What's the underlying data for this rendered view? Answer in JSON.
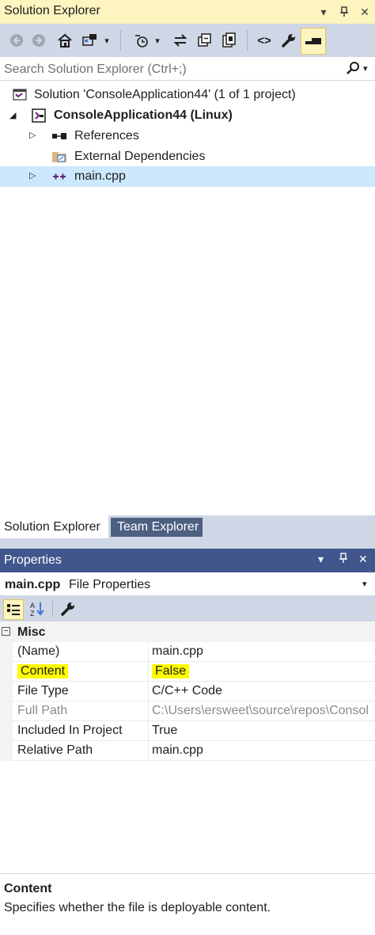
{
  "solution_explorer": {
    "title": "Solution Explorer",
    "title_buttons": [
      "dropdown-icon",
      "pin-icon",
      "close-icon"
    ],
    "toolbar": [
      "back-icon",
      "forward-icon",
      "home-icon",
      "switch-views-icon",
      "dropdown-icon",
      "pending-changes-icon",
      "dropdown-icon",
      "sync-icon",
      "collapse-all-icon",
      "show-all-files-icon",
      "view-code-icon",
      "properties-wrench-icon",
      "preview-selected-icon"
    ],
    "search_placeholder": "Search Solution Explorer (Ctrl+;)",
    "tree": {
      "solution": "Solution 'ConsoleApplication44' (1 of 1 project)",
      "project": "ConsoleApplication44 (Linux)",
      "references": "References",
      "external": "External Dependencies",
      "main": "main.cpp"
    }
  },
  "tabs": {
    "solution_explorer": "Solution Explorer",
    "team_explorer": "Team Explorer"
  },
  "properties": {
    "title": "Properties",
    "object_name": "main.cpp",
    "object_type": "File Properties",
    "category": "Misc",
    "rows": [
      {
        "key": "(Name)",
        "value": "main.cpp"
      },
      {
        "key": "Content",
        "value": "False"
      },
      {
        "key": "File Type",
        "value": "C/C++ Code"
      },
      {
        "key": "Full Path",
        "value": "C:\\Users\\ersweet\\source\\repos\\Consol"
      },
      {
        "key": "Included In Project",
        "value": "True"
      },
      {
        "key": "Relative Path",
        "value": "main.cpp"
      }
    ],
    "description_title": "Content",
    "description_text": "Specifies whether the file is deployable content."
  },
  "colors": {
    "active_title": "#fdf4bf",
    "toolbar": "#cfd6e5",
    "inactive_title": "#40568d",
    "selection": "#cce8ff",
    "highlight": "#fffb00"
  }
}
